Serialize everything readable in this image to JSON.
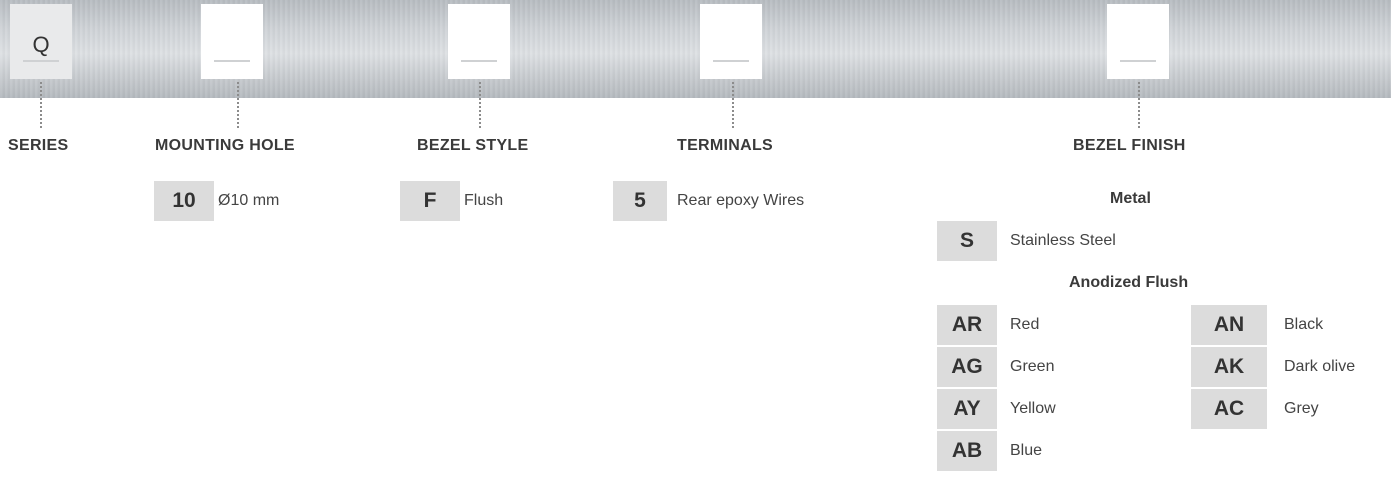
{
  "series": {
    "code": "Q",
    "label": "SERIES"
  },
  "mounting_hole": {
    "label": "MOUNTING HOLE",
    "options": [
      {
        "code": "10",
        "desc": "Ø10 mm"
      }
    ]
  },
  "bezel_style": {
    "label": "BEZEL STYLE",
    "options": [
      {
        "code": "F",
        "desc": "Flush"
      }
    ]
  },
  "terminals": {
    "label": "TERMINALS",
    "options": [
      {
        "code": "5",
        "desc": "Rear epoxy Wires"
      }
    ]
  },
  "bezel_finish": {
    "label": "BEZEL FINISH",
    "metal": {
      "title": "Metal",
      "options": [
        {
          "code": "S",
          "desc": "Stainless Steel"
        }
      ]
    },
    "anodized": {
      "title": "Anodized Flush",
      "left": [
        {
          "code": "AR",
          "desc": "Red"
        },
        {
          "code": "AG",
          "desc": "Green"
        },
        {
          "code": "AY",
          "desc": "Yellow"
        },
        {
          "code": "AB",
          "desc": "Blue"
        }
      ],
      "right": [
        {
          "code": "AN",
          "desc": "Black"
        },
        {
          "code": "AK",
          "desc": "Dark olive"
        },
        {
          "code": "AC",
          "desc": "Grey"
        }
      ]
    }
  }
}
